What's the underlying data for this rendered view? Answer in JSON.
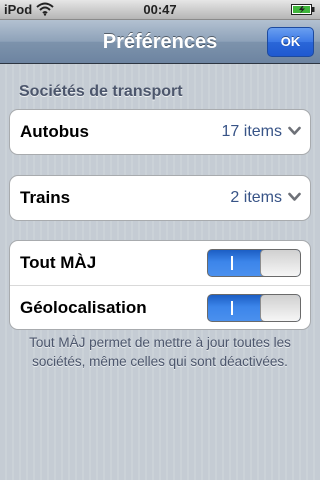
{
  "status_bar": {
    "carrier": "iPod",
    "time": "00:47",
    "icons": [
      "wifi-icon",
      "battery-charging-icon"
    ]
  },
  "nav": {
    "title": "Préférences",
    "ok_label": "OK"
  },
  "section": {
    "header": "Sociétés de transport"
  },
  "transport": {
    "autobus": {
      "label": "Autobus",
      "value": "17 items",
      "icon": "chevron-down-icon"
    },
    "trains": {
      "label": "Trains",
      "value": "2 items",
      "icon": "chevron-down-icon"
    }
  },
  "settings": {
    "update_all": {
      "label": "Tout MÀJ",
      "state": "on",
      "on_text": "I"
    },
    "geolocation": {
      "label": "Géolocalisation",
      "state": "on",
      "on_text": "I"
    }
  },
  "footer_note": "Tout MÀJ permet de mettre à jour toutes les sociétés, même celles qui sont déactivées.",
  "colors": {
    "accent": "#2a66d8",
    "toggle_on": "#3c85ea",
    "value_text": "#385487",
    "background": "#c5ccd4"
  }
}
